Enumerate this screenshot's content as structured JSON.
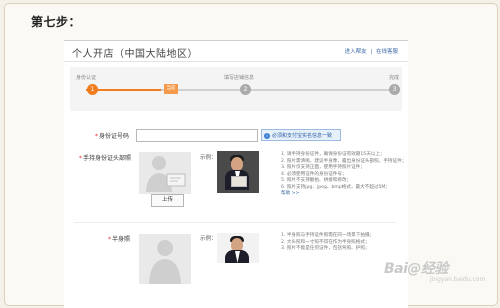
{
  "step_note": "第七步：",
  "page": {
    "title": "个人开店（中国大陆地区）",
    "toplinks": [
      "进入帮友",
      "|",
      "在线客服"
    ]
  },
  "steps": {
    "labels": [
      "身份认证",
      "填写店铺信息",
      "完成"
    ],
    "numbers": [
      "1",
      "2",
      "3"
    ],
    "current_tag": "当前"
  },
  "form": {
    "id_label": "身份证号码",
    "id_value": "",
    "verify_text": "必须和支付宝实名信息一致",
    "handheld_label": "手持身份证头部照",
    "example_label": "示例：",
    "upload_button": "上传",
    "tips1": [
      "1. 请手持身份证件，确保身份证有效期15天以上；",
      "2. 照片需清晰，建议半身像，露出身份证头部照，手持证件；",
      "3. 照片仅支持正面，使用手持照片证件；",
      "4. 必须使用证件的身份证件号；",
      "5. 照片不支持翻拍、拼接和修改；",
      "6. 照片支持jpg、jpeg、bmp格式，最大不超过5M；"
    ],
    "help_link": "帮助 >>",
    "half_label": "半身照",
    "tips2": [
      "1. 半身照与手持证件照需在同一场景下拍摄；",
      "2. 大头照和一寸照不得在作为半身照格式；",
      "3. 照片不能是任何证件，包括驾照、护照；"
    ]
  },
  "watermark": "Bai@经验",
  "watermark_sub": "jingyan.baidu.com",
  "colors": {
    "accent": "#f07d1e",
    "link": "#3c6aa6",
    "required": "#e03030"
  }
}
